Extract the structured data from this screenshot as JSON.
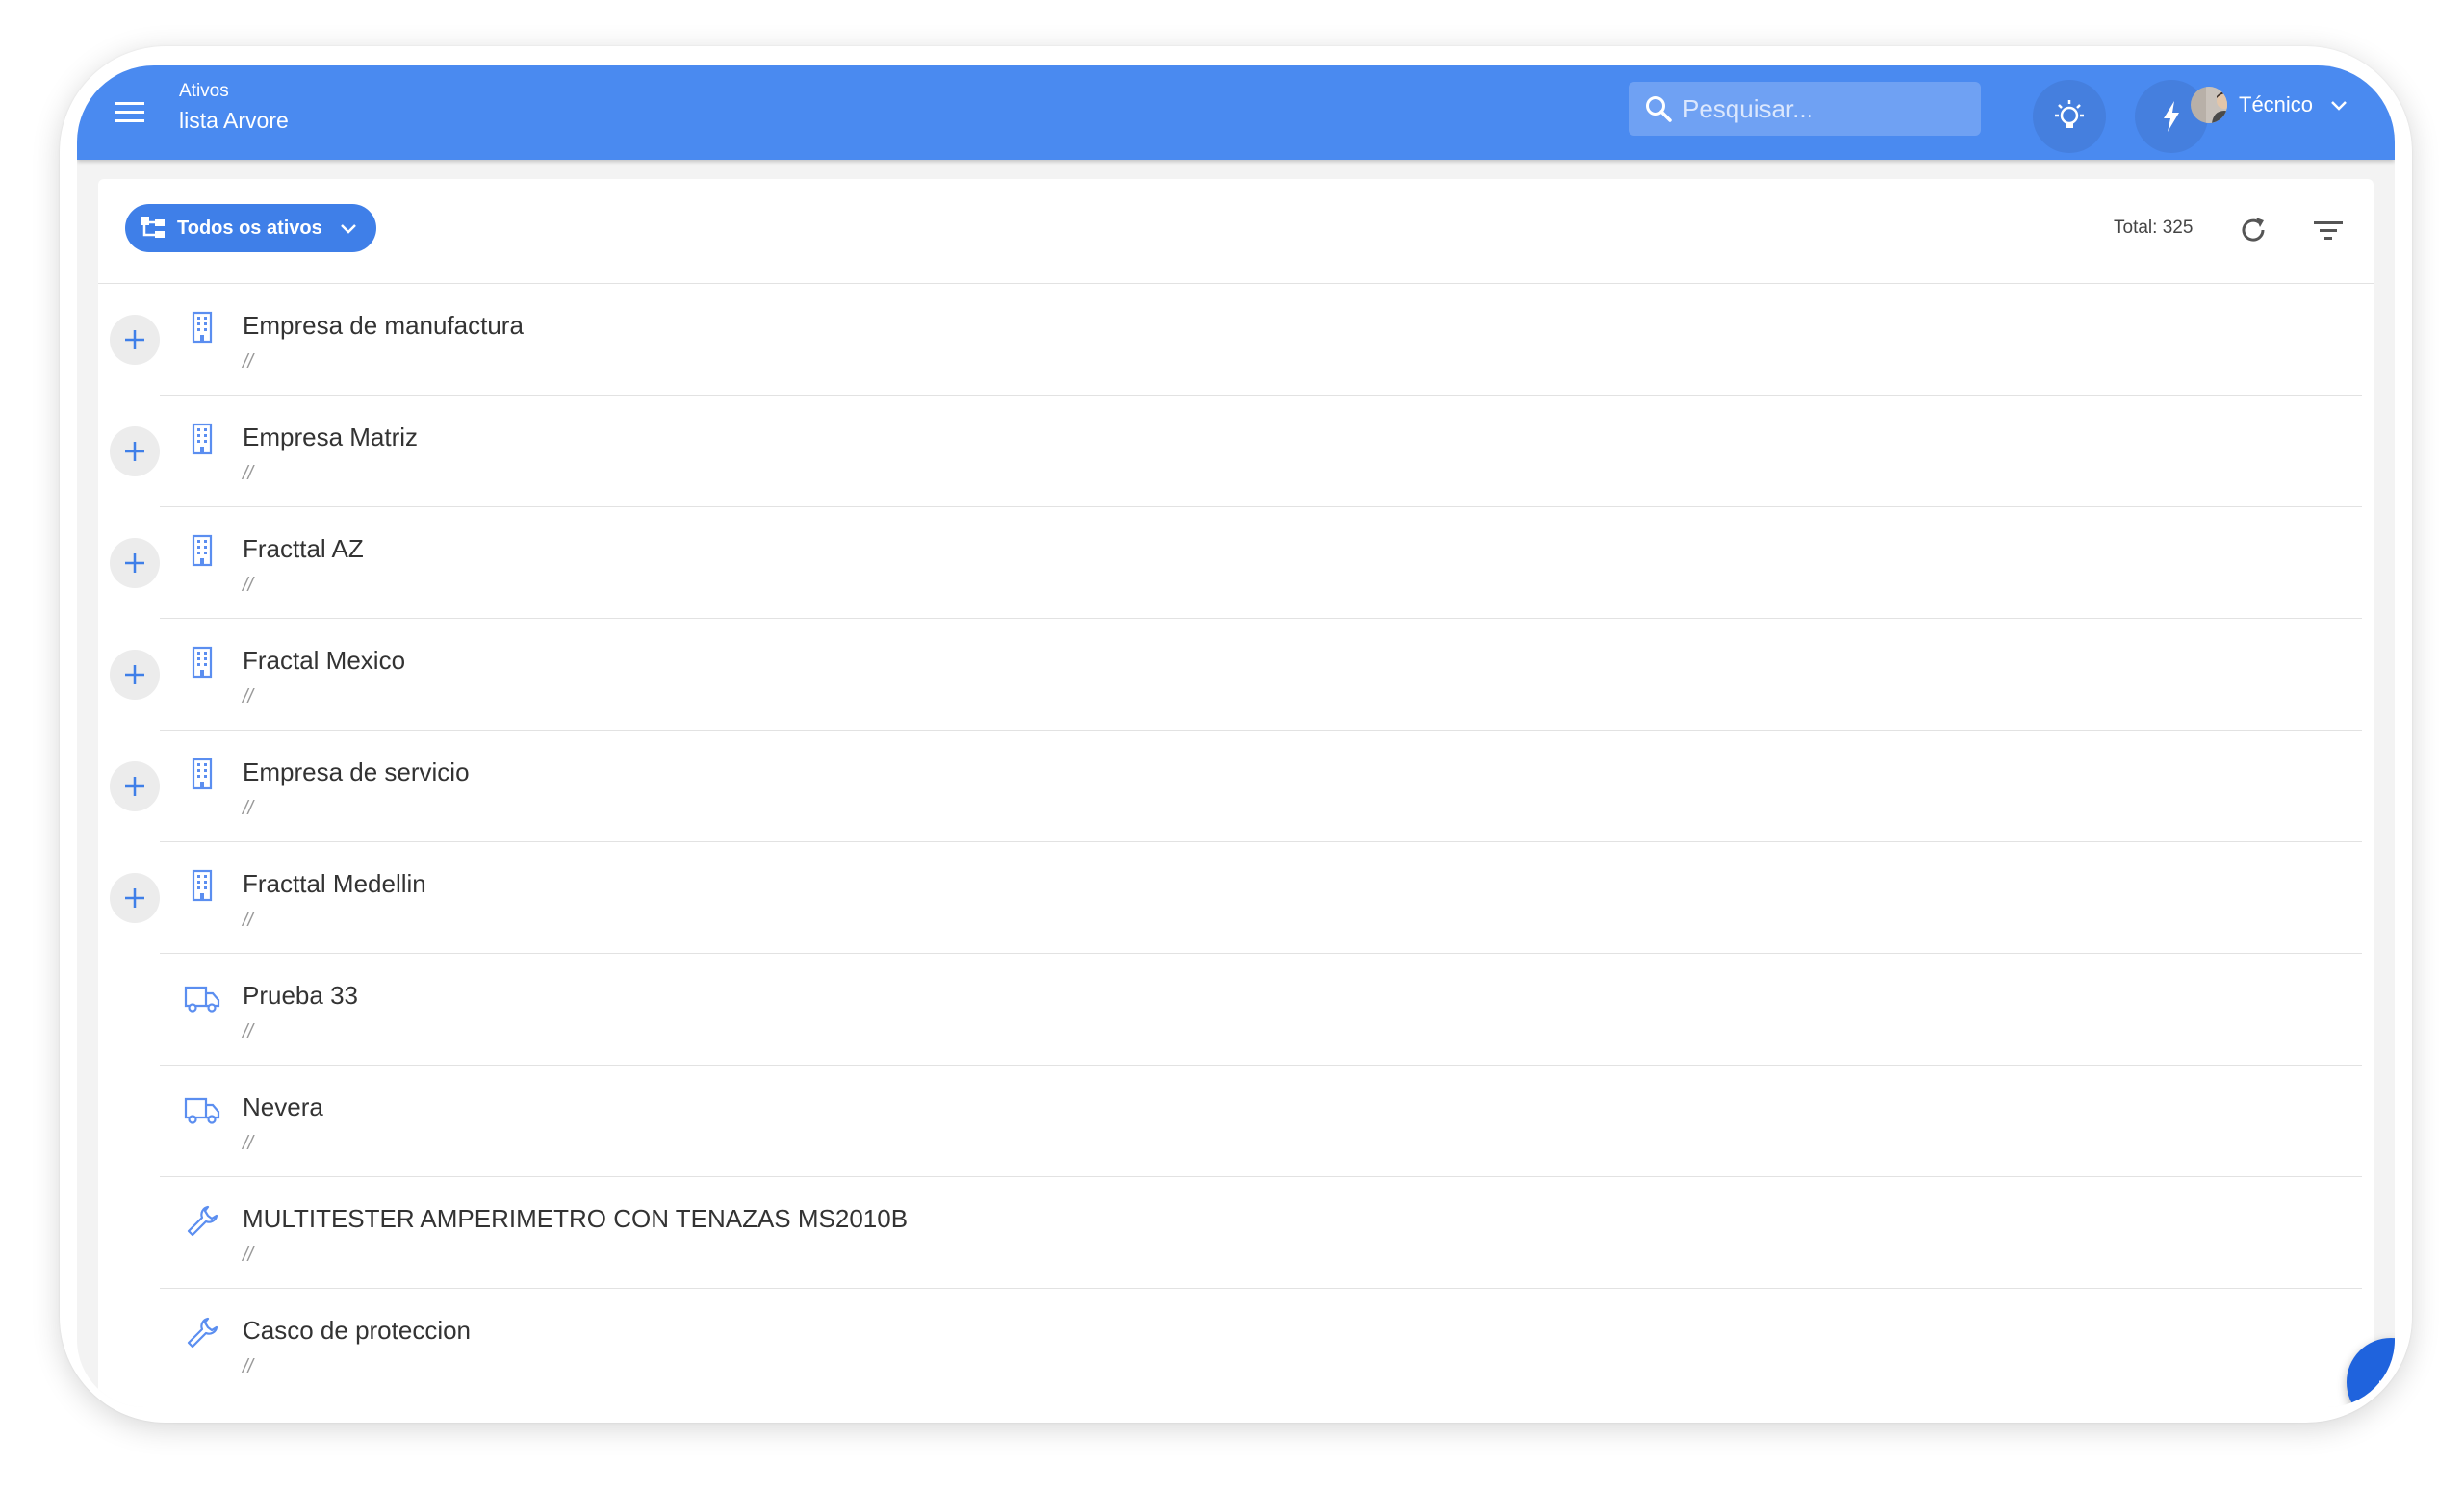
{
  "header": {
    "breadcrumb_parent": "Ativos",
    "title": "lista Arvore",
    "search_placeholder": "Pesquisar...",
    "user_name": "Técnico",
    "brand_color": "#4a8af0"
  },
  "toolbar": {
    "filter_label": "Todos os ativos",
    "total_label": "Total: 325"
  },
  "assets": [
    {
      "name": "Empresa de manufactura",
      "path": "//",
      "type": "building-icon",
      "expandable": true
    },
    {
      "name": "Empresa Matriz",
      "path": "//",
      "type": "building-icon",
      "expandable": true
    },
    {
      "name": "Fracttal AZ",
      "path": "//",
      "type": "building-icon",
      "expandable": true
    },
    {
      "name": "Fractal Mexico",
      "path": "//",
      "type": "building-icon",
      "expandable": true
    },
    {
      "name": "Empresa de servicio",
      "path": "//",
      "type": "building-icon",
      "expandable": true
    },
    {
      "name": "Fracttal Medellin",
      "path": "//",
      "type": "building-icon",
      "expandable": true
    },
    {
      "name": "Prueba 33",
      "path": "//",
      "type": "truck-icon",
      "expandable": false
    },
    {
      "name": "Nevera",
      "path": "//",
      "type": "truck-icon",
      "expandable": false
    },
    {
      "name": "MULTITESTER AMPERIMETRO CON TENAZAS MS2010B",
      "path": "//",
      "type": "wrench-icon",
      "expandable": false
    },
    {
      "name": "Casco de proteccion",
      "path": "//",
      "type": "wrench-icon",
      "expandable": false
    }
  ]
}
